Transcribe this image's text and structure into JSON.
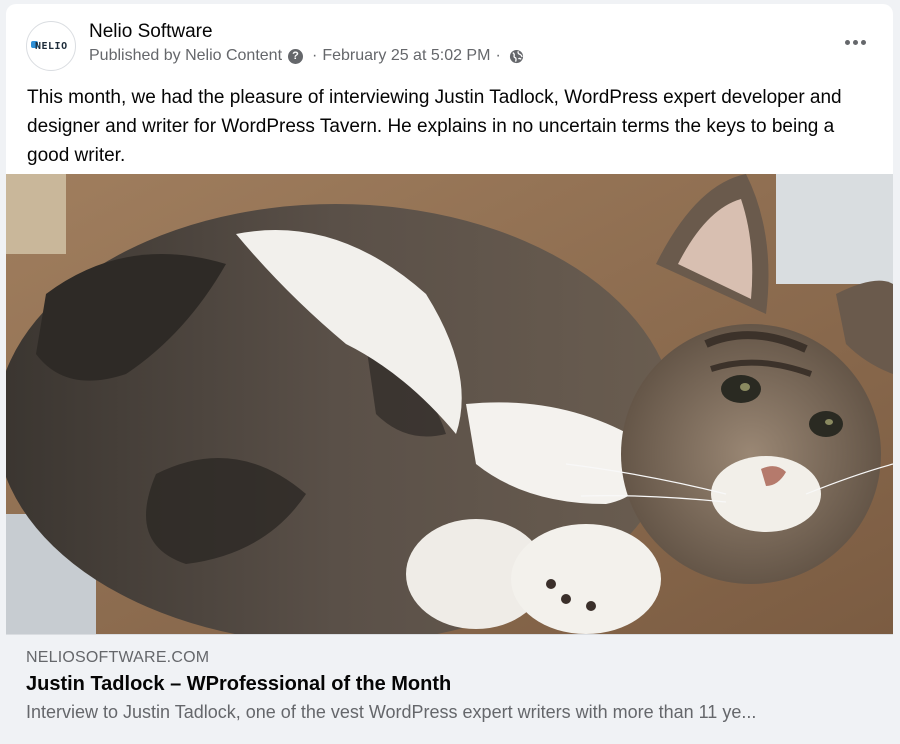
{
  "post": {
    "page_name": "Nelio Software",
    "avatar_logo_text": "NELIO",
    "published_by": "Published by Nelio Content",
    "help_glyph": "?",
    "separator": "·",
    "timestamp": "February 25 at 5:02 PM",
    "privacy_icon": "globe-icon",
    "more_icon": "more-horizontal-icon",
    "message": "This month, we had the pleasure of interviewing Justin Tadlock, WordPress expert developer and designer and writer for WordPress Tavern. He explains in no uncertain terms the keys to being a good writer.",
    "image_subject": "tabby cat lying in a cardboard box"
  },
  "link_preview": {
    "domain": "NELIOSOFTWARE.COM",
    "title": "Justin Tadlock – WProfessional of the Month",
    "description": "Interview to Justin Tadlock, one of the vest WordPress expert writers with more than 11 ye..."
  },
  "colors": {
    "primary_text": "#050505",
    "secondary_text": "#65676b",
    "card_background": "#f0f2f5",
    "logo_blue": "#2e8fd6"
  }
}
